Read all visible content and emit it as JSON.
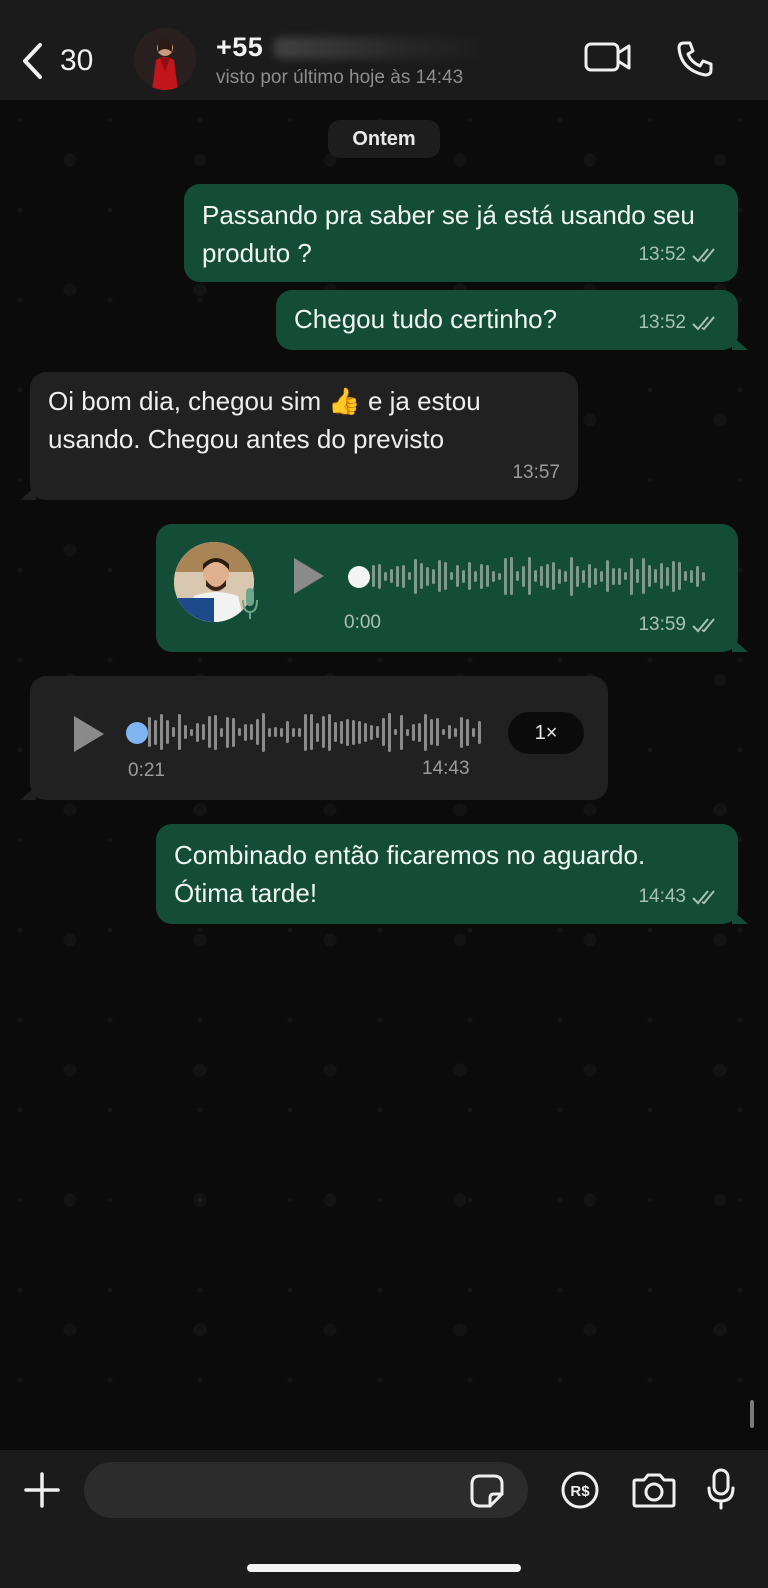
{
  "header": {
    "back_count": "30",
    "contact_name": "+55",
    "contact_status": "visto por último hoje às 14:43"
  },
  "chat": {
    "date_label": "Ontem",
    "messages": [
      {
        "direction": "out",
        "text": "Passando pra saber se já está usando seu produto ?",
        "time": "13:52"
      },
      {
        "direction": "out",
        "text": "Chegou tudo certinho?",
        "time": "13:52"
      },
      {
        "direction": "in",
        "text": "Oi bom dia, chegou sim 👍 e ja estou usando. Chegou antes do previsto",
        "time": "13:57"
      },
      {
        "direction": "out",
        "type": "voice",
        "duration": "0:00",
        "time": "13:59"
      },
      {
        "direction": "in",
        "type": "voice",
        "duration": "0:21",
        "time": "14:43",
        "speed": "1×"
      },
      {
        "direction": "out",
        "text": "Combinado então ficaremos no aguardo. Ótima tarde!",
        "time": "14:43"
      }
    ]
  },
  "composer": {
    "placeholder": ""
  },
  "icons": {
    "back": "chevron-left-icon",
    "video": "video-call-icon",
    "phone": "phone-icon",
    "plus": "plus-icon",
    "sticker": "sticker-icon",
    "payment": "payment-rs-icon",
    "camera": "camera-icon",
    "mic": "mic-icon"
  },
  "colors": {
    "outgoing_bubble": "#144d37",
    "incoming_bubble": "#212121",
    "background": "#0b0b0b",
    "header": "#1b1b1b",
    "read_ticks": "#a9c1b4",
    "audio_dot_in": "#7fb5f2"
  }
}
